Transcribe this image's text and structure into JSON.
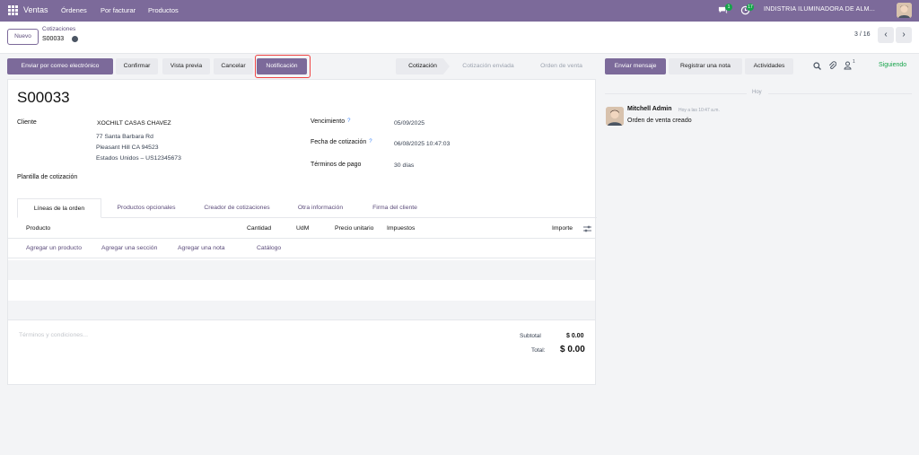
{
  "topbar": {
    "app_name": "Ventas",
    "menu": [
      "Órdenes",
      "Por facturar",
      "Productos"
    ],
    "chat_badge": "1",
    "activity_badge": "17",
    "company": "INDISTRIA ILUMINADORA DE ALM...",
    "icons": [
      "apps-grid-icon",
      "chat-icon",
      "clock-icon",
      "user-avatar"
    ]
  },
  "control_panel": {
    "new_label": "Nuevo",
    "breadcrumb_parent": "Cotizaciones",
    "breadcrumb_current": "S00033",
    "pager": "3 / 16"
  },
  "actions": {
    "send_email": "Enviar por correo electrónico",
    "confirm": "Confirmar",
    "preview": "Vista previa",
    "cancel": "Cancelar",
    "notification": "Notificación"
  },
  "status_bar": [
    "Cotización",
    "Cotización enviada",
    "Orden de venta"
  ],
  "form": {
    "title": "S00033",
    "client_label": "Cliente",
    "client_lines": [
      "XOCHILT CASAS CHAVEZ",
      "77 Santa Barbara Rd",
      "Pleasant Hill CA 94523",
      "Estados Unidos – US12345673"
    ],
    "template_label": "Plantilla de cotización",
    "expiry_label": "Vencimiento",
    "expiry_value": "05/09/2025",
    "quote_date_label": "Fecha de cotización",
    "quote_date_value": "06/08/2025 10:47:03",
    "payment_terms_label": "Términos de pago",
    "payment_terms_value": "30 días",
    "required_mark": "?",
    "tabs": [
      "Líneas de la orden",
      "Productos opcionales",
      "Creador de cotizaciones",
      "Otra información",
      "Firma del cliente"
    ],
    "columns": [
      "Producto",
      "Cantidad",
      "UdM",
      "Precio unitario",
      "Impuestos",
      "Importe"
    ],
    "add_links": [
      "Agregar un producto",
      "Agregar una sección",
      "Agregar una nota",
      "Catálogo"
    ],
    "terms_placeholder": "Términos y condiciones...",
    "subtotal_label": "Subtotal",
    "subtotal_value": "$ 0.00",
    "total_label": "Total:",
    "total_value": "$ 0.00"
  },
  "chatter": {
    "send_message": "Enviar mensaje",
    "log_note": "Registrar una nota",
    "activities": "Actividades",
    "followers_count": "1",
    "following": "Siguiendo",
    "day_separator": "Hoy",
    "message": {
      "author": "Mitchell Admin",
      "time": "Hoy a las 10:47 a.m.",
      "body": "Orden de venta creado"
    }
  },
  "colors": {
    "brand": "#7c6a9a",
    "following_green": "#16a34a",
    "highlight_red": "#ef4444"
  }
}
